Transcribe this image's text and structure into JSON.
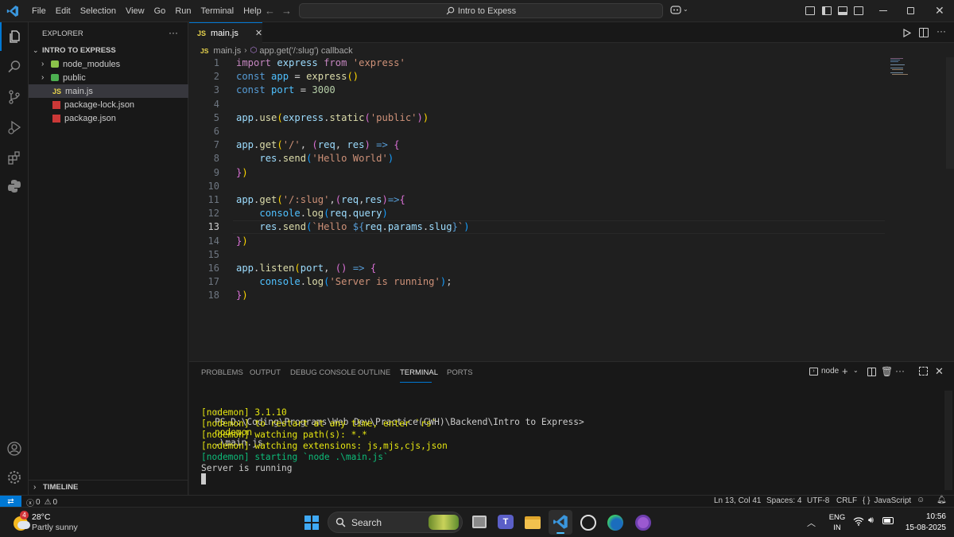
{
  "menu": [
    "File",
    "Edit",
    "Selection",
    "View",
    "Go",
    "Run",
    "Terminal",
    "Help"
  ],
  "command_center": "Intro to Expess",
  "explorer": {
    "title": "EXPLORER",
    "more": "···",
    "root": "INTRO TO EXPRESS",
    "items": [
      {
        "label": "node_modules",
        "type": "folder"
      },
      {
        "label": "public",
        "type": "folder"
      },
      {
        "label": "main.js",
        "type": "js"
      },
      {
        "label": "package-lock.json",
        "type": "npm"
      },
      {
        "label": "package.json",
        "type": "npm"
      }
    ],
    "timeline": "TIMELINE"
  },
  "editor": {
    "tab_badge": "JS",
    "tab_label": "main.js",
    "breadcrumb_file": "main.js",
    "breadcrumb_symbol": "app.get('/:slug') callback",
    "current_line": 13,
    "lines": [
      "import express from 'express'",
      "const app = express()",
      "const port = 3000",
      "",
      "app.use(express.static('public'))",
      "",
      "app.get('/', (req, res) => {",
      "    res.send('Hello World')",
      "})",
      "",
      "app.get('/:slug',(req,res)=>{",
      "    console.log(req.query)",
      "    res.send(`Hello ${req.params.slug}`)",
      "})",
      "",
      "app.listen(port, () => {",
      "    console.log('Server is running');",
      "})"
    ]
  },
  "panel": {
    "tabs": [
      "PROBLEMS",
      "OUTPUT",
      "DEBUG CONSOLE",
      "OUTLINE",
      "TERMINAL",
      "PORTS"
    ],
    "active_tab": "TERMINAL",
    "terminal_name": "node",
    "prompt": "PS D:\\Coding\\Programs\\Web Dev\\Practice(CWH)\\Backend\\Intro to Express>",
    "command": "nodemon",
    "command_arg": ".\\main.js",
    "output": [
      {
        "text": "[nodemon] 3.1.10",
        "color": "#e5e510"
      },
      {
        "text": "[nodemon] to restart at any time, enter `rs`",
        "color": "#e5e510"
      },
      {
        "text": "[nodemon] watching path(s): *.*",
        "color": "#e5e510"
      },
      {
        "text": "[nodemon] watching extensions: js,mjs,cjs,json",
        "color": "#e5e510"
      },
      {
        "text": "[nodemon] starting `node .\\main.js`",
        "color": "#0dbc79"
      },
      {
        "text": "Server is running",
        "color": "#cccccc"
      }
    ]
  },
  "status": {
    "errors": "0",
    "warnings": "0",
    "position": "Ln 13, Col 41",
    "spaces": "Spaces: 4",
    "encoding": "UTF-8",
    "eol": "CRLF",
    "language": "JavaScript",
    "language_icon": "{ }"
  },
  "taskbar": {
    "weather_badge": "4",
    "temperature": "28°C",
    "weather": "Partly sunny",
    "search": "Search",
    "lang": "ENG",
    "region": "IN",
    "time": "10:56",
    "date": "15-08-2025"
  },
  "colors": {
    "accent": "#0078d4",
    "remote": "#0078d4",
    "background": "#1f1f1f"
  }
}
